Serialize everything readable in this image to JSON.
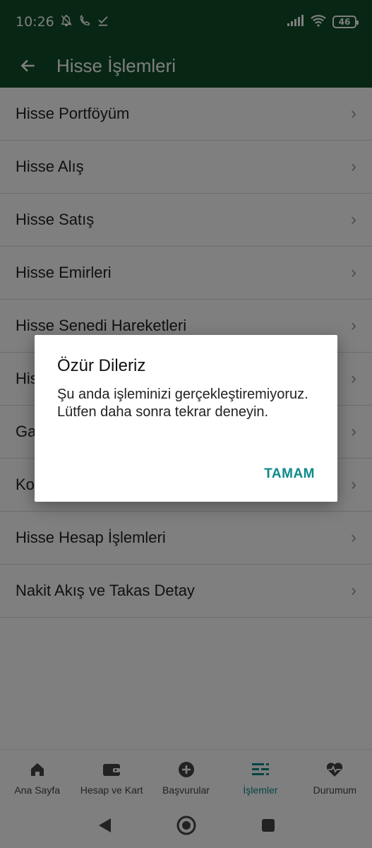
{
  "statusbar": {
    "time": "10:26",
    "battery": "46"
  },
  "appbar": {
    "title": "Hisse İşlemleri"
  },
  "list": [
    {
      "label": "Hisse Portföyüm"
    },
    {
      "label": "Hisse Alış"
    },
    {
      "label": "Hisse Satış"
    },
    {
      "label": "Hisse Emirleri"
    },
    {
      "label": "Hisse Senedi Hareketleri"
    },
    {
      "label": "His"
    },
    {
      "label": "Ga"
    },
    {
      "label": "Ko"
    },
    {
      "label": "Hisse Hesap İşlemleri"
    },
    {
      "label": "Nakit Akış ve Takas Detay"
    }
  ],
  "bottomnav": [
    {
      "label": "Ana Sayfa",
      "icon": "home-icon"
    },
    {
      "label": "Hesap ve Kart",
      "icon": "wallet-icon"
    },
    {
      "label": "Başvurular",
      "icon": "plus-circle-icon"
    },
    {
      "label": "İşlemler",
      "icon": "list-icon",
      "active": true
    },
    {
      "label": "Durumum",
      "icon": "heart-pulse-icon"
    }
  ],
  "dialog": {
    "title": "Özür Dileriz",
    "body": "Şu anda işleminizi gerçekleştiremiyoruz. Lütfen daha sonra tekrar deneyin.",
    "ok_label": "TAMAM"
  },
  "colors": {
    "brand": "#0e4d26",
    "accent": "#0d8a8a"
  }
}
